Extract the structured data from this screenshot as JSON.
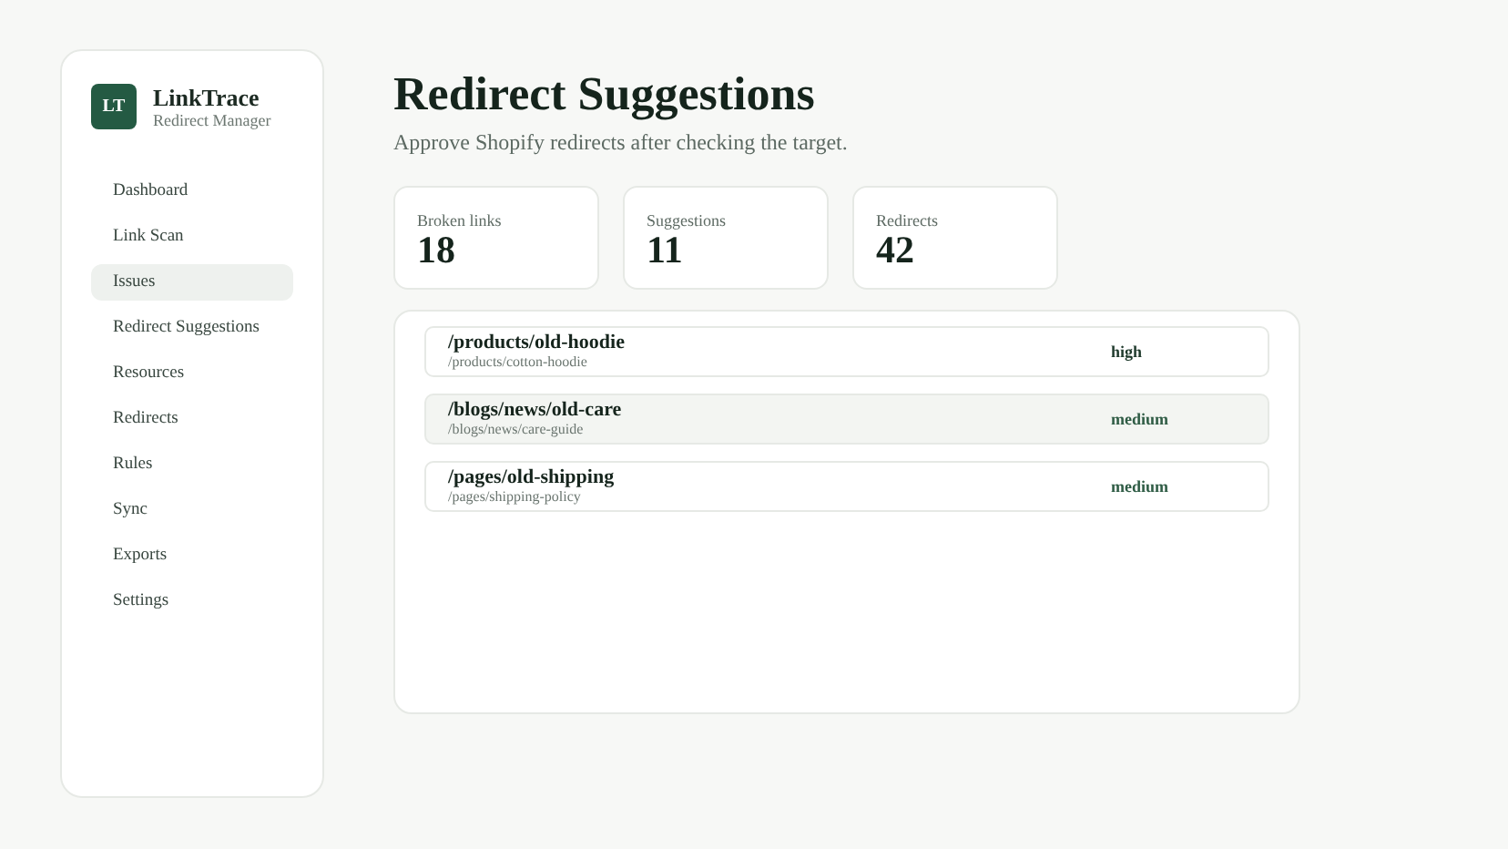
{
  "brand": {
    "logo": "LT",
    "name": "LinkTrace",
    "subtitle": "Redirect Manager"
  },
  "sidebar": {
    "items": [
      {
        "label": "Dashboard",
        "selected": false
      },
      {
        "label": "Link Scan",
        "selected": false
      },
      {
        "label": "Issues",
        "selected": true
      },
      {
        "label": "Redirect Suggestions",
        "selected": false
      },
      {
        "label": "Resources",
        "selected": false
      },
      {
        "label": "Redirects",
        "selected": false
      },
      {
        "label": "Rules",
        "selected": false
      },
      {
        "label": "Sync",
        "selected": false
      },
      {
        "label": "Exports",
        "selected": false
      },
      {
        "label": "Settings",
        "selected": false
      }
    ]
  },
  "page": {
    "title": "Redirect Suggestions",
    "subtitle": "Approve Shopify redirects after checking the target."
  },
  "stats": [
    {
      "label": "Broken links",
      "value": "18"
    },
    {
      "label": "Suggestions",
      "value": "11"
    },
    {
      "label": "Redirects",
      "value": "42"
    }
  ],
  "suggestions": [
    {
      "source": "/products/old-hoodie",
      "target": "/products/cotton-hoodie",
      "confidence": "high",
      "color": "#1f3a2c",
      "selected": false
    },
    {
      "source": "/blogs/news/old-care",
      "target": "/blogs/news/care-guide",
      "confidence": "medium",
      "color": "#2f5c45",
      "selected": true
    },
    {
      "source": "/pages/old-shipping",
      "target": "/pages/shipping-policy",
      "confidence": "medium",
      "color": "#2f5c45",
      "selected": false
    }
  ]
}
